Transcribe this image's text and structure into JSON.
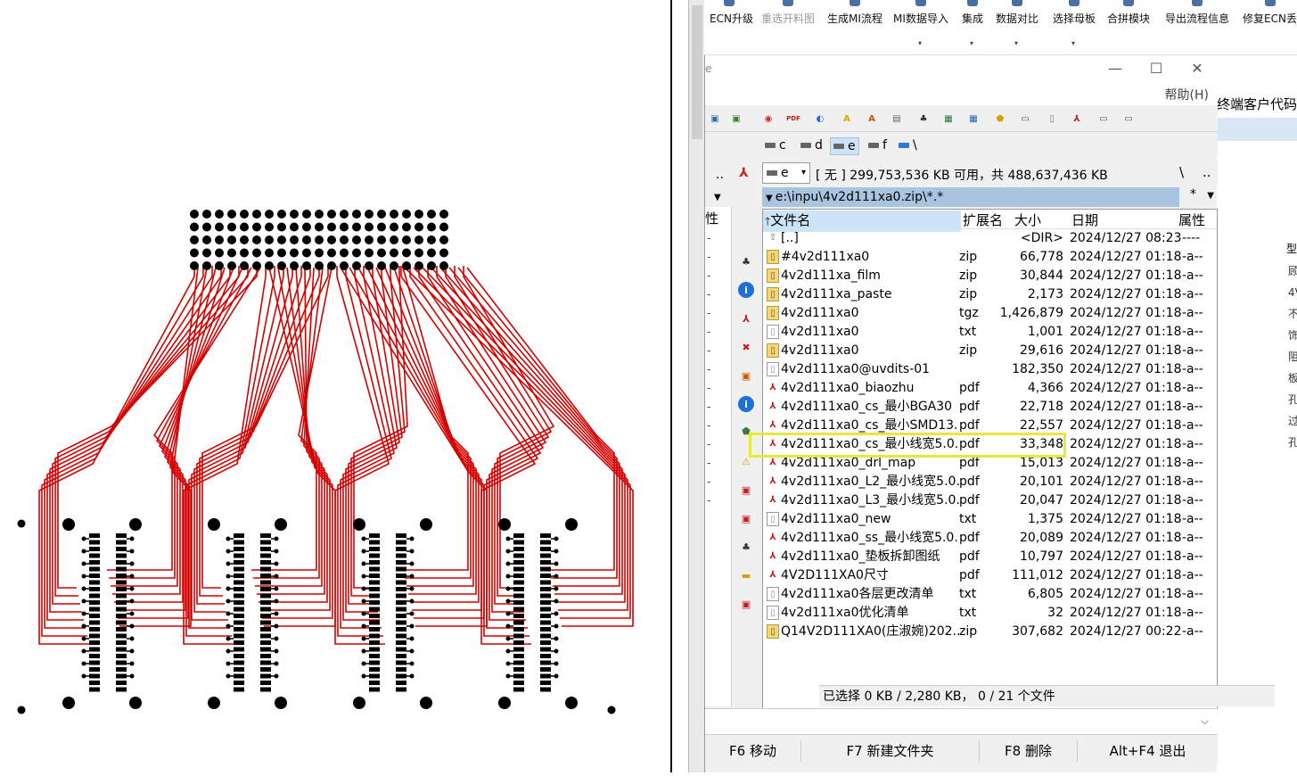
{
  "toolbar": {
    "items": [
      {
        "label": "ECN升级",
        "has_dropdown": false,
        "enabled": true
      },
      {
        "label": "重选开料图",
        "has_dropdown": false,
        "enabled": false
      },
      {
        "label": "生成MI流程",
        "has_dropdown": false,
        "enabled": true
      },
      {
        "label": "MI数据导入",
        "has_dropdown": true,
        "enabled": true
      },
      {
        "label": "集成",
        "has_dropdown": true,
        "enabled": true
      },
      {
        "label": "数据对比",
        "has_dropdown": true,
        "enabled": true
      },
      {
        "label": "选择母板",
        "has_dropdown": true,
        "enabled": true
      },
      {
        "label": "合拼模块",
        "has_dropdown": false,
        "enabled": true
      },
      {
        "label": "导出流程信息",
        "has_dropdown": false,
        "enabled": true
      },
      {
        "label": "修复ECN丢表",
        "has_dropdown": false,
        "enabled": true
      }
    ]
  },
  "window": {
    "app_fragment": "e",
    "minimize": "—",
    "maximize": "☐",
    "close": "✕",
    "help_menu": "帮助(H)"
  },
  "drives": {
    "items": [
      {
        "label": "c",
        "selected": false
      },
      {
        "label": "d",
        "selected": false
      },
      {
        "label": "e",
        "selected": true
      },
      {
        "label": "f",
        "selected": false
      },
      {
        "label": "\\",
        "selected": false
      }
    ]
  },
  "left_panel": {
    "dots": "..",
    "header": "性",
    "rows": [
      "-",
      "-",
      "-",
      "-",
      "-",
      "-",
      "-",
      "-",
      "-",
      "-",
      "-",
      "-",
      "-",
      "-",
      "-"
    ]
  },
  "right_panel": {
    "drive_select": "e",
    "free_space": "[ 无 ]  299,753,536 KB 可用，共 488,637,436 KB",
    "root_button": "\\",
    "up_button": "..",
    "path": "e:\\inpu\\4v2d111xa0.zip\\*.*",
    "filter": "*",
    "columns": {
      "name": "文件名",
      "ext": "扩展名",
      "size": "大小",
      "date": "日期",
      "attr": "属性"
    },
    "files": [
      {
        "name": "[..]",
        "ext": "",
        "size": "<DIR>",
        "date": "2024/12/27 08:23",
        "attr": "----",
        "icon": "up-icon"
      },
      {
        "name": "#4v2d111xa0",
        "ext": "zip",
        "size": "66,778",
        "date": "2024/12/27 01:18",
        "attr": "-a--",
        "icon": "zip-icon"
      },
      {
        "name": "4v2d111xa_film",
        "ext": "zip",
        "size": "30,844",
        "date": "2024/12/27 01:18",
        "attr": "-a--",
        "icon": "zip-icon"
      },
      {
        "name": "4v2d111xa_paste",
        "ext": "zip",
        "size": "2,173",
        "date": "2024/12/27 01:18",
        "attr": "-a--",
        "icon": "zip-icon"
      },
      {
        "name": "4v2d111xa0",
        "ext": "tgz",
        "size": "1,426,879",
        "date": "2024/12/27 01:18",
        "attr": "-a--",
        "icon": "zip-icon"
      },
      {
        "name": "4v2d111xa0",
        "ext": "txt",
        "size": "1,001",
        "date": "2024/12/27 01:18",
        "attr": "-a--",
        "icon": "txt-icon"
      },
      {
        "name": "4v2d111xa0",
        "ext": "zip",
        "size": "29,616",
        "date": "2024/12/27 01:18",
        "attr": "-a--",
        "icon": "zip-icon"
      },
      {
        "name": "4v2d111xa0@uvdits-01",
        "ext": "",
        "size": "182,350",
        "date": "2024/12/27 01:18",
        "attr": "-a--",
        "icon": "txt-icon"
      },
      {
        "name": "4v2d111xa0_biaozhu",
        "ext": "pdf",
        "size": "4,366",
        "date": "2024/12/27 01:18",
        "attr": "-a--",
        "icon": "pdf-icon"
      },
      {
        "name": "4v2d111xa0_cs_最小BGA30",
        "ext": "pdf",
        "size": "22,718",
        "date": "2024/12/27 01:18",
        "attr": "-a--",
        "icon": "pdf-icon"
      },
      {
        "name": "4v2d111xa0_cs_最小SMD13...",
        "ext": "pdf",
        "size": "22,557",
        "date": "2024/12/27 01:18",
        "attr": "-a--",
        "icon": "pdf-icon"
      },
      {
        "name": "4v2d111xa0_cs_最小线宽5.0...",
        "ext": "pdf",
        "size": "33,348",
        "date": "2024/12/27 01:18",
        "attr": "-a--",
        "icon": "pdf-icon"
      },
      {
        "name": "4v2d111xa0_drl_map",
        "ext": "pdf",
        "size": "15,013",
        "date": "2024/12/27 01:18",
        "attr": "-a--",
        "icon": "pdf-icon"
      },
      {
        "name": "4v2d111xa0_L2_最小线宽5.0...",
        "ext": "pdf",
        "size": "20,101",
        "date": "2024/12/27 01:18",
        "attr": "-a--",
        "icon": "pdf-icon"
      },
      {
        "name": "4v2d111xa0_L3_最小线宽5.0...",
        "ext": "pdf",
        "size": "20,047",
        "date": "2024/12/27 01:18",
        "attr": "-a--",
        "icon": "pdf-icon"
      },
      {
        "name": "4v2d111xa0_new",
        "ext": "txt",
        "size": "1,375",
        "date": "2024/12/27 01:18",
        "attr": "-a--",
        "icon": "txt-icon"
      },
      {
        "name": "4v2d111xa0_ss_最小线宽5.0...",
        "ext": "pdf",
        "size": "20,089",
        "date": "2024/12/27 01:18",
        "attr": "-a--",
        "icon": "pdf-icon"
      },
      {
        "name": "4v2d111xa0_垫板拆卸图纸",
        "ext": "pdf",
        "size": "10,797",
        "date": "2024/12/27 01:18",
        "attr": "-a--",
        "icon": "pdf-icon"
      },
      {
        "name": "4V2D111XA0尺寸",
        "ext": "pdf",
        "size": "111,012",
        "date": "2024/12/27 01:18",
        "attr": "-a--",
        "icon": "pdf-icon"
      },
      {
        "name": "4v2d111xa0各层更改清单",
        "ext": "txt",
        "size": "6,805",
        "date": "2024/12/27 01:18",
        "attr": "-a--",
        "icon": "txt-icon"
      },
      {
        "name": "4v2d111xa0优化清单",
        "ext": "txt",
        "size": "32",
        "date": "2024/12/27 01:18",
        "attr": "-a--",
        "icon": "txt-icon"
      },
      {
        "name": "Q14V2D111XA0(庄淑婉)202...",
        "ext": "zip",
        "size": "307,682",
        "date": "2024/12/27 00:22",
        "attr": "-a--",
        "icon": "zip-icon"
      }
    ],
    "highlighted_row": 11,
    "status": "已选择 0 KB / 2,280 KB，  0 / 21 个文件"
  },
  "function_keys": [
    {
      "label": "F6 移动"
    },
    {
      "label": "F7 新建文件夹"
    },
    {
      "label": "F8 删除"
    },
    {
      "label": "Alt+F4 退出"
    }
  ],
  "background_window": {
    "header": "终端客户代码",
    "col_label": "型",
    "side_chars": [
      "顾",
      "4V",
      "不",
      "饰",
      "阻",
      "板",
      "孔",
      "过",
      "孔"
    ]
  },
  "colors": {
    "trace": "#d40000",
    "pad": "#000000",
    "highlight": "#e8e83a",
    "path_bar": "#a8c4e0",
    "selected_drive": "#cde3f7"
  }
}
